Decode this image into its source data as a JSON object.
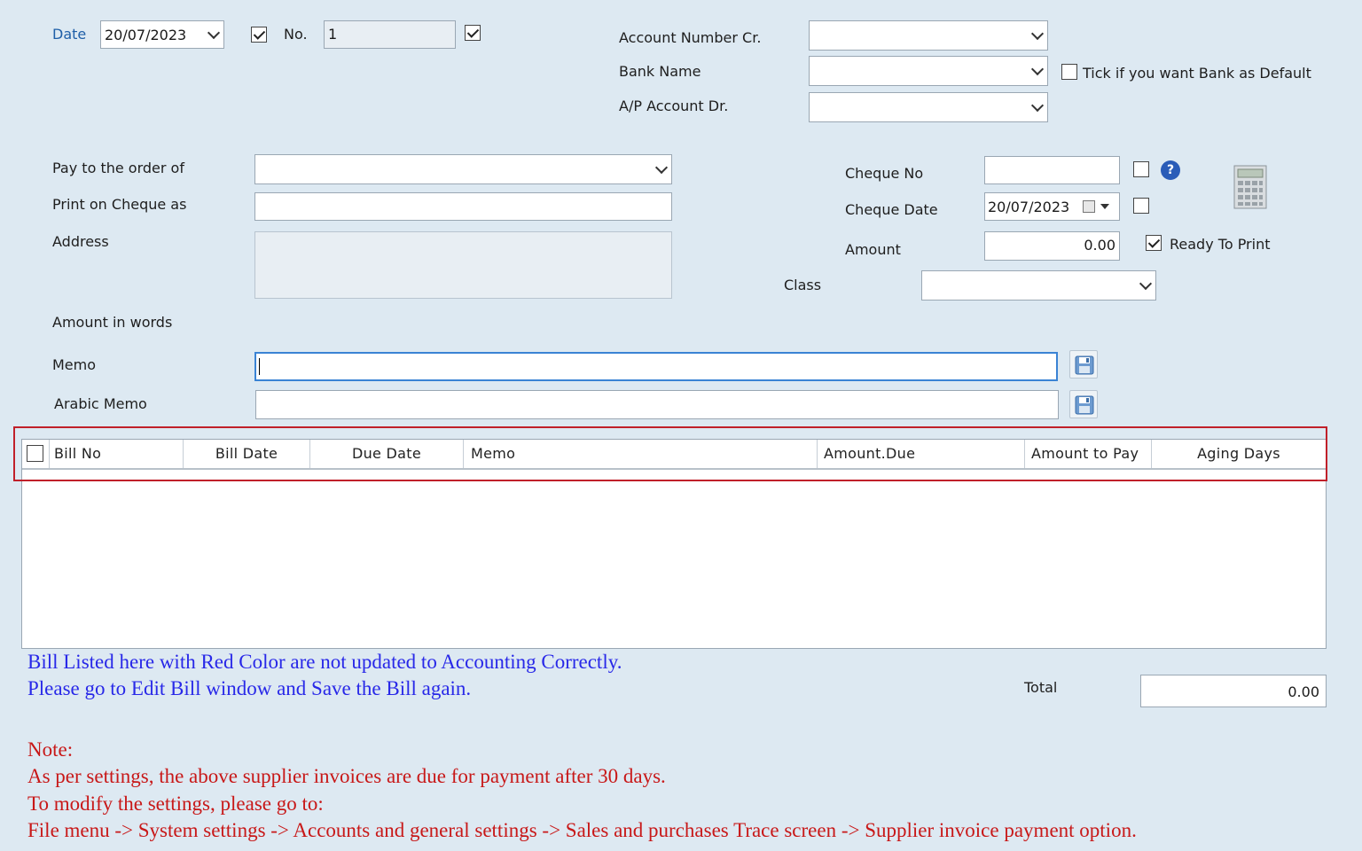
{
  "header": {
    "date_label": "Date",
    "date_value": "20/07/2023",
    "no_label": "No.",
    "no_value": "1",
    "account_number_cr_label": "Account Number Cr.",
    "bank_name_label": "Bank Name",
    "ap_account_dr_label": "A/P Account Dr.",
    "bank_default_label": "Tick if you want Bank as Default"
  },
  "payee": {
    "pay_to_label": "Pay to the order of",
    "print_on_cheque_label": "Print on Cheque as",
    "address_label": "Address",
    "amount_in_words_label": "Amount in words",
    "memo_label": "Memo",
    "arabic_memo_label": "Arabic Memo"
  },
  "cheque": {
    "cheque_no_label": "Cheque No",
    "cheque_date_label": "Cheque Date",
    "cheque_date_value": "20/07/2023",
    "amount_label": "Amount",
    "amount_value": "0.00",
    "ready_to_print_label": "Ready To Print",
    "class_label": "Class"
  },
  "grid": {
    "columns": [
      "Bill No",
      "Bill Date",
      "Due Date",
      "Memo",
      "Amount.Due",
      "Amount to Pay",
      "Aging Days"
    ]
  },
  "footer": {
    "total_label": "Total",
    "total_value": "0.00",
    "info_line1": "Bill Listed here with Red Color are not updated to Accounting Correctly.",
    "info_line2": "Please go to Edit Bill window and Save the Bill again.",
    "note_title": "Note:",
    "note_line1": "As per settings, the above supplier invoices are due for payment after 30 days.",
    "note_line2": "To modify the settings, please go to:",
    "note_line3": "File menu -> System settings -> Accounts and general settings  -> Sales and purchases Trace screen -> Supplier invoice payment option."
  },
  "state": {
    "date_checkbox": true,
    "no_checkbox": true,
    "bank_default_checkbox": false,
    "cheque_no_checkbox": false,
    "cheque_date_checkbox": false,
    "ready_to_print_checkbox": true,
    "select_all_checkbox": false
  },
  "icons": {
    "help": "help-icon",
    "calculator": "calculator-icon",
    "save": "save-icon",
    "calendar": "calendar-icon"
  },
  "colors": {
    "background": "#dde9f2",
    "info_text": "#2828e8",
    "note_text": "#c81818",
    "highlight_border": "#c0202a",
    "accent_label": "#1f5fa8"
  }
}
